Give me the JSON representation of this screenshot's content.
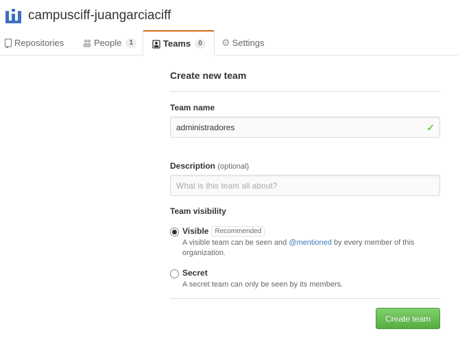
{
  "org": {
    "name": "campusciff-juangarciaciff",
    "avatar_icon": "org-logo-icon"
  },
  "tabs": [
    {
      "label": "Repositories",
      "icon": "repo-icon",
      "count": null
    },
    {
      "label": "People",
      "icon": "people-icon",
      "count": "1"
    },
    {
      "label": "Teams",
      "icon": "team-icon",
      "count": "0",
      "active": true
    },
    {
      "label": "Settings",
      "icon": "gear-icon",
      "count": null
    }
  ],
  "form": {
    "title": "Create new team",
    "team_name_label": "Team name",
    "team_name_value": "administradores",
    "description_label": "Description",
    "description_optional": "(optional)",
    "description_placeholder": "What is this team all about?",
    "visibility_label": "Team visibility",
    "visible": {
      "title": "Visible",
      "badge": "Recommended",
      "note_before": "A visible team can be seen and ",
      "note_link": "@mentioned",
      "note_after": " by every member of this organization.",
      "checked": true
    },
    "secret": {
      "title": "Secret",
      "note": "A secret team can only be seen by its members.",
      "checked": false
    },
    "submit_label": "Create team"
  },
  "colors": {
    "accent_tab": "#d26911",
    "success": "#6cc644",
    "link": "#4078c0",
    "button": "#56ac42"
  }
}
